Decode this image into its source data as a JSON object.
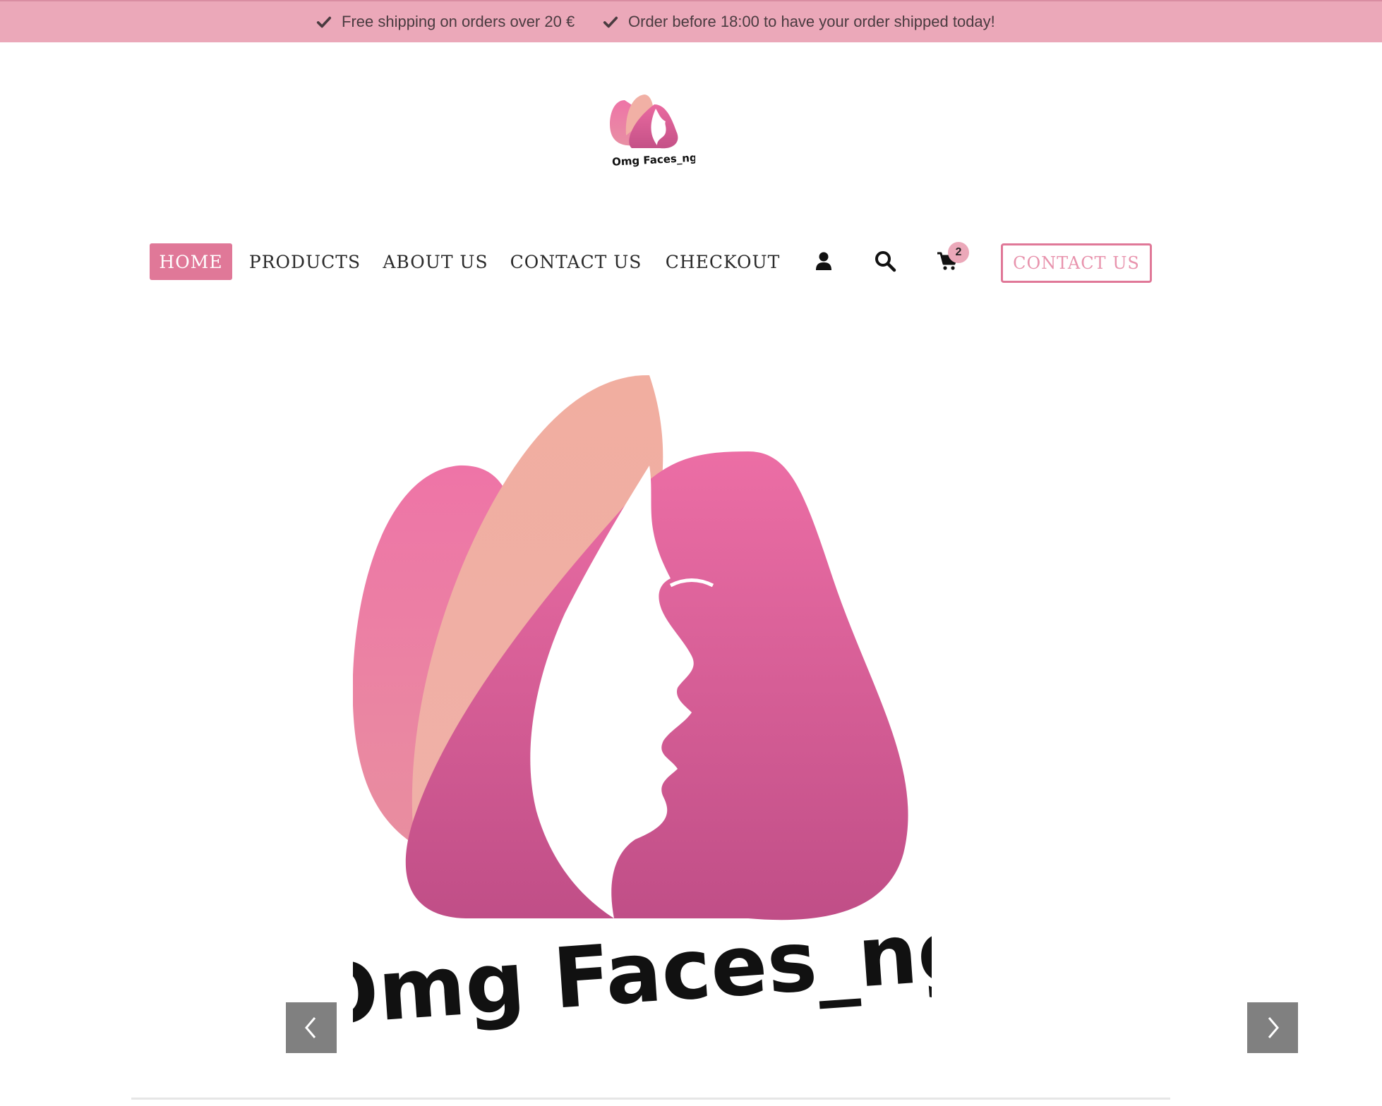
{
  "topbar": {
    "items": [
      {
        "icon": "check-icon",
        "text": "Free shipping on orders over 20 €"
      },
      {
        "icon": "check-icon",
        "text": "Order before 18:00 to have your order shipped today!"
      }
    ],
    "background": "#eba8b9"
  },
  "header": {
    "logo_text": "Omg Faces_ng"
  },
  "nav": {
    "items": [
      {
        "label": "HOME",
        "active": true
      },
      {
        "label": "PRODUCTS",
        "active": false
      },
      {
        "label": "ABOUT US",
        "active": false
      },
      {
        "label": "CONTACT US",
        "active": false
      },
      {
        "label": "CHECKOUT",
        "active": false
      }
    ],
    "icons": [
      "user-icon",
      "search-icon",
      "cart-icon"
    ],
    "cart_count": "2",
    "cta_label": "CONTACT US"
  },
  "hero": {
    "logo_text": "Omg Faces_ng",
    "prev_icon": "chevron-left-icon",
    "next_icon": "chevron-right-icon"
  },
  "colors": {
    "accent": "#e07898",
    "pink_light": "#eba8b9",
    "peach": "#f0b0a2",
    "logo_pink": "#e56a9e"
  }
}
